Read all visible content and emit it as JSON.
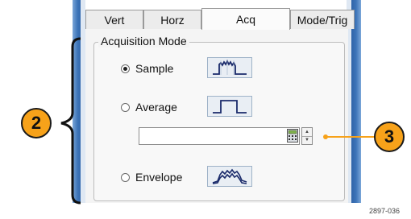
{
  "tabs": [
    {
      "label": "Vert",
      "active": false
    },
    {
      "label": "Horz",
      "active": false
    },
    {
      "label": "Acq",
      "active": true
    },
    {
      "label": "Mode/Trig",
      "active": false
    }
  ],
  "acquisition": {
    "group_label": "Acquisition Mode",
    "modes": [
      {
        "label": "Sample",
        "selected": true,
        "icon": "sample-waveform-icon"
      },
      {
        "label": "Average",
        "selected": false,
        "icon": "average-waveform-icon"
      },
      {
        "label": "Envelope",
        "selected": false,
        "icon": "envelope-waveform-icon"
      }
    ],
    "average_count": {
      "value": ""
    }
  },
  "callouts": [
    {
      "number": "2"
    },
    {
      "number": "3"
    }
  ],
  "figure_code": "2897-036",
  "colors": {
    "callout": "#f7a21a",
    "callout_line": "#f7a21a",
    "frame": "#3d74b8"
  }
}
